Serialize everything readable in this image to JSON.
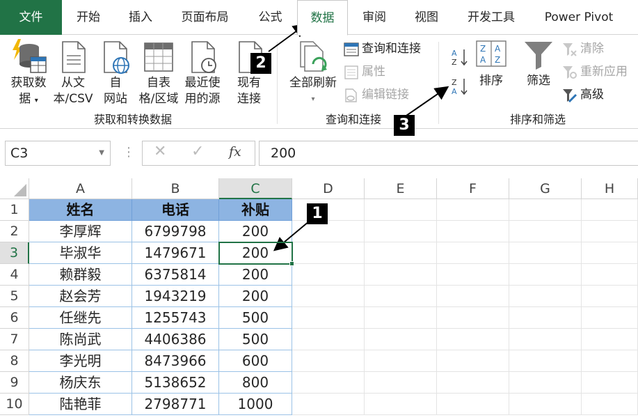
{
  "tabs": [
    {
      "label": "文件"
    },
    {
      "label": "开始"
    },
    {
      "label": "插入"
    },
    {
      "label": "页面布局"
    },
    {
      "label": "公式"
    },
    {
      "label": "数据"
    },
    {
      "label": "审阅"
    },
    {
      "label": "视图"
    },
    {
      "label": "开发工具"
    },
    {
      "label": "Power Pivot"
    }
  ],
  "ribbon": {
    "get_data_l1": "获取数",
    "get_data_l2": "据",
    "from_text_l1": "从文",
    "from_text_l2": "本/CSV",
    "from_web_l1": "自",
    "from_web_l2": "网站",
    "from_table_l1": "自表",
    "from_table_l2": "格/区域",
    "recent_l1": "最近使",
    "recent_l2": "用的源",
    "existing_l1": "现有",
    "existing_l2": "连接",
    "group_get": "获取和转换数据",
    "refresh_all": "全部刷新",
    "queries_conn": "查询和连接",
    "properties": "属性",
    "edit_links": "编辑链接",
    "group_queries": "查询和连接",
    "sort": "排序",
    "filter": "筛选",
    "clear": "清除",
    "reapply": "重新应用",
    "advanced": "高级",
    "group_sort": "排序和筛选"
  },
  "formula_bar": {
    "name_box": "C3",
    "value": "200",
    "fx": "fx"
  },
  "columns": [
    "A",
    "B",
    "C",
    "D",
    "E",
    "F",
    "G",
    "H"
  ],
  "rows": [
    "1",
    "2",
    "3",
    "4",
    "5",
    "6",
    "7",
    "8",
    "9",
    "10"
  ],
  "table": {
    "headers": [
      "姓名",
      "电话",
      "补贴"
    ],
    "data": [
      [
        "李厚辉",
        "6799798",
        "200"
      ],
      [
        "毕淑华",
        "1479671",
        "200"
      ],
      [
        "赖群毅",
        "6375814",
        "200"
      ],
      [
        "赵会芳",
        "1943219",
        "200"
      ],
      [
        "任继先",
        "1255743",
        "500"
      ],
      [
        "陈尚武",
        "4406386",
        "500"
      ],
      [
        "李光明",
        "8473966",
        "600"
      ],
      [
        "杨庆东",
        "5138652",
        "800"
      ],
      [
        "陆艳菲",
        "2798771",
        "1000"
      ]
    ]
  },
  "callouts": {
    "one": "1",
    "two": "2",
    "three": "3"
  },
  "colors": {
    "excel_green": "#217346",
    "header_fill": "#8db4e2",
    "table_border": "#9bc2e6"
  }
}
